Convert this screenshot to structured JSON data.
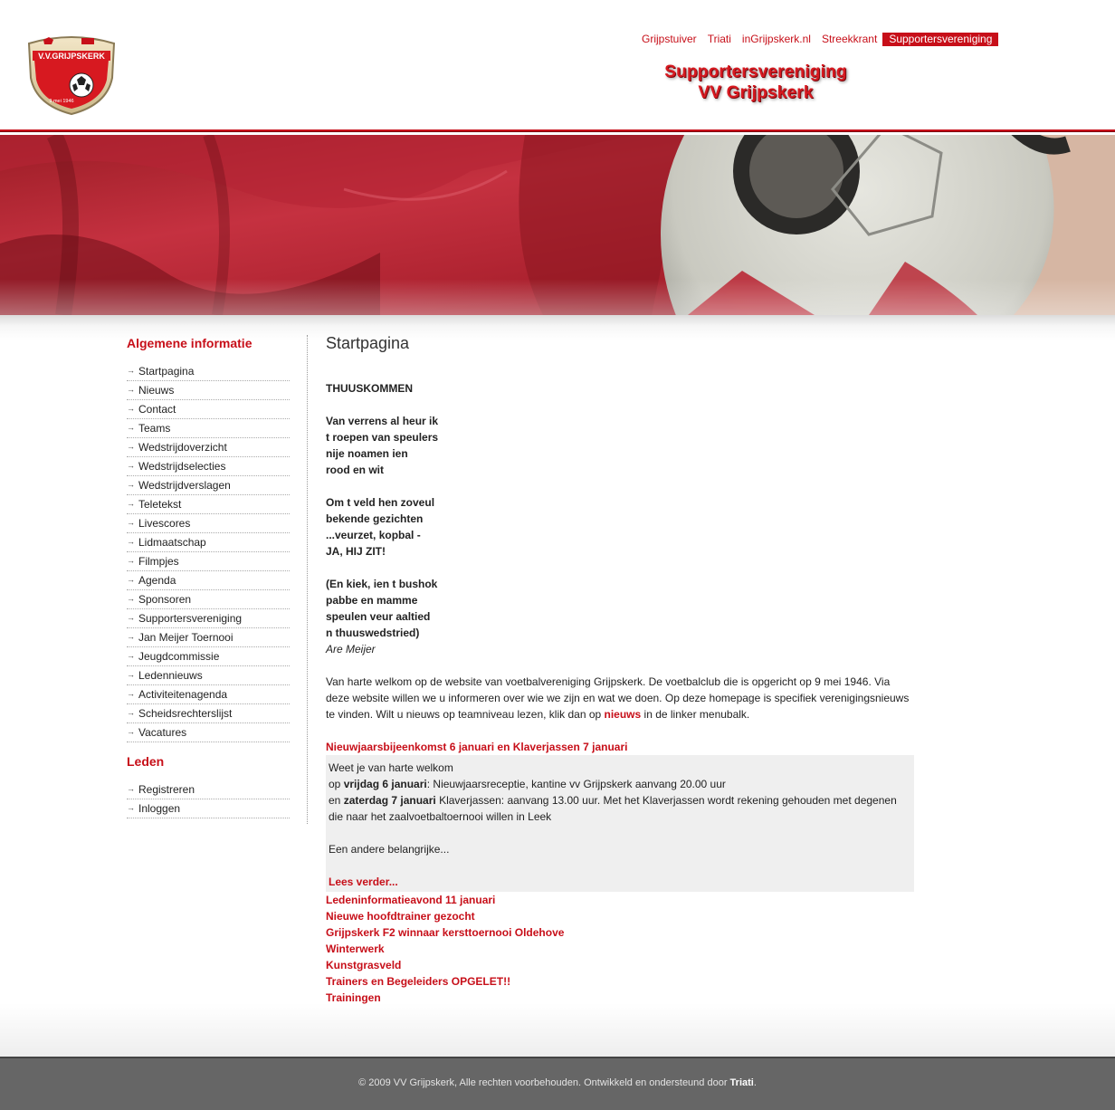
{
  "header": {
    "logo_text": "V.V.GRIJPSKERK",
    "logo_date": "9 mei 1946",
    "nav": [
      {
        "label": "Grijpstuiver",
        "active": false
      },
      {
        "label": "Triati",
        "active": false
      },
      {
        "label": "inGrijpskerk.nl",
        "active": false
      },
      {
        "label": "Streekkrant",
        "active": false
      },
      {
        "label": "Supportersvereniging",
        "active": true
      }
    ],
    "title_line1": "Supportersvereniging",
    "title_line2": "VV Grijpskerk"
  },
  "sidebar": {
    "heading_general": "Algemene informatie",
    "general_items": [
      "Startpagina",
      "Nieuws",
      "Contact",
      "Teams",
      "Wedstrijdoverzicht",
      "Wedstrijdselecties",
      "Wedstrijdverslagen",
      "Teletekst",
      "Livescores",
      "Lidmaatschap",
      "Filmpjes",
      "Agenda",
      "Sponsoren",
      "Supportersvereniging",
      "Jan Meijer Toernooi",
      "Jeugdcommissie",
      "Ledennieuws",
      "Activiteitenagenda",
      "Scheidsrechterslijst",
      "Vacatures"
    ],
    "heading_members": "Leden",
    "member_items": [
      "Registreren",
      "Inloggen"
    ]
  },
  "main": {
    "title": "Startpagina",
    "poem_title": "THUUSKOMMEN",
    "stanza1": [
      "Van verrens al heur ik",
      "t roepen van speulers",
      "nije noamen ien",
      "rood en wit"
    ],
    "stanza2": [
      "Om t veld hen zoveul",
      "bekende gezichten",
      "...veurzet, kopbal -",
      "JA, HIJ ZIT!"
    ],
    "stanza3": [
      "(En kiek, ien t bushok",
      "pabbe en mamme",
      "speulen veur aaltied",
      "n thuuswedstried)"
    ],
    "author": "Are Meijer",
    "intro_before": "Van harte welkom op de website van voetbalvereniging Grijpskerk. De voetbalclub die is opgericht op 9 mei 1946. Via deze website willen we u informeren over wie we zijn en wat we doen. Op deze homepage is specifiek verenigingsnieuws te vinden. Wilt u nieuws op teamniveau lezen, klik dan op ",
    "intro_link": "nieuws",
    "intro_after": " in de linker menubalk.",
    "featured": {
      "title": "Nieuwjaarsbijeenkomst 6 januari en Klaverjassen 7 januari",
      "line1": "Weet je van harte welkom",
      "line2_pre": "op ",
      "line2_bold": "vrijdag 6 januari",
      "line2_post": ": Nieuwjaarsreceptie, kantine vv Grijpskerk aanvang 20.00 uur",
      "line3_pre": "en ",
      "line3_bold": "zaterdag 7 januari",
      "line3_post": " Klaverjassen: aanvang 13.00 uur. Met het Klaverjassen wordt rekening gehouden met degenen die naar het zaalvoetbaltoernooi willen in Leek",
      "teaser": "Een andere belangrijke...",
      "readmore": "Lees verder..."
    },
    "news": [
      "Ledeninformatieavond 11 januari",
      "Nieuwe hoofdtrainer gezocht",
      "Grijpskerk F2 winnaar kersttoernooi Oldehove",
      "Winterwerk",
      "Kunstgrasveld",
      "Trainers en Begeleiders OPGELET!!",
      "Trainingen"
    ]
  },
  "footer": {
    "text": "© 2009 VV Grijpskerk, Alle rechten voorbehouden. Ontwikkeld en ondersteund door ",
    "link": "Triati",
    "end": "."
  },
  "colors": {
    "brand_red": "#c70f19",
    "footer_gray": "#666666"
  }
}
